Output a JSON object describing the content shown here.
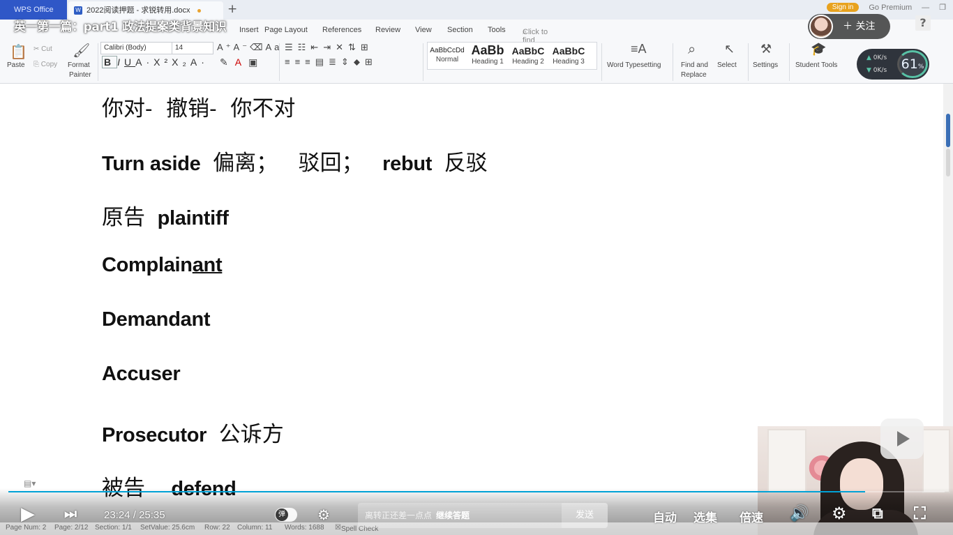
{
  "app": {
    "wps_tab": "WPS Office",
    "doc_tab": "2022阅读押题 - 求锐转用.docx",
    "sign_in": "Sign in",
    "go_premium": "Go Premium"
  },
  "menu": {
    "items": [
      "Insert",
      "Page Layout",
      "References",
      "Review",
      "View",
      "Section",
      "Tools"
    ],
    "search_placeholder": "Click to find commands"
  },
  "toolbar": {
    "paste": "Paste",
    "cut": "Cut",
    "copy": "Copy",
    "format": "Format",
    "painter": "Painter",
    "font_name": "Calibri (Body)",
    "font_size": "14",
    "styles": [
      {
        "sample": "AaBbCcDd",
        "name": "Normal"
      },
      {
        "sample": "AaBb",
        "name": "Heading 1"
      },
      {
        "sample": "AaBbC",
        "name": "Heading 2"
      },
      {
        "sample": "AaBbC",
        "name": "Heading 3"
      }
    ],
    "word_typesetting": "Word Typesetting",
    "find_and": "Find and",
    "replace": "Replace",
    "select": "Select",
    "settings": "Settings",
    "student_tools": "Student Tools"
  },
  "document": {
    "lines": [
      {
        "segments": [
          {
            "t": "你对-  撤销-  你不对",
            "s": "zh"
          }
        ]
      },
      {
        "segments": [
          {
            "t": "Turn aside ",
            "s": "en"
          },
          {
            "t": " 偏离；   驳回；  ",
            "s": "zh"
          },
          {
            "t": " rebut ",
            "s": "en"
          },
          {
            "t": " 反驳",
            "s": "zh"
          }
        ]
      },
      {
        "segments": [
          {
            "t": "原告 ",
            "s": "zh"
          },
          {
            "t": " plaintiff",
            "s": "en"
          }
        ]
      },
      {
        "segments": [
          {
            "t": "Complain",
            "s": "en"
          },
          {
            "t": "ant",
            "s": "en-u"
          }
        ]
      },
      {
        "segments": [
          {
            "t": "Demandant",
            "s": "en"
          }
        ]
      },
      {
        "segments": [
          {
            "t": "Accuser",
            "s": "en"
          }
        ]
      },
      {
        "segments": [
          {
            "t": "Prosecutor ",
            "s": "en"
          },
          {
            "t": " 公诉方",
            "s": "zh"
          }
        ]
      },
      {
        "segments": [
          {
            "t": "被告   ",
            "s": "zh"
          },
          {
            "t": " defend",
            "s": "en"
          }
        ]
      }
    ]
  },
  "video": {
    "title": "英一第一篇：part1 政法提案类背景知识",
    "follow": "关注",
    "net_up": "0K/s",
    "net_down": "0K/s",
    "cpu": "61",
    "cpu_unit": "%",
    "current_time": "23:24",
    "total_time": "25:35",
    "progress": 0.915,
    "danmu_badge": "弹",
    "danmu_placeholder": "离转正还差一点点",
    "danmu_action": "继续答题",
    "send": "发送",
    "auto": "自动",
    "episodes": "选集",
    "speed": "倍速"
  },
  "status": {
    "page_num": "Page Num: 2",
    "page": "Page: 2/12",
    "section": "Section: 1/1",
    "set_value": "SetValue: 25.6cm",
    "row": "Row: 22",
    "column": "Column: 11",
    "words": "Words: 1688",
    "spell_check": "Spell Check"
  },
  "colors": {
    "accent": "#00a1d6",
    "wps_blue": "#2f57c7"
  }
}
